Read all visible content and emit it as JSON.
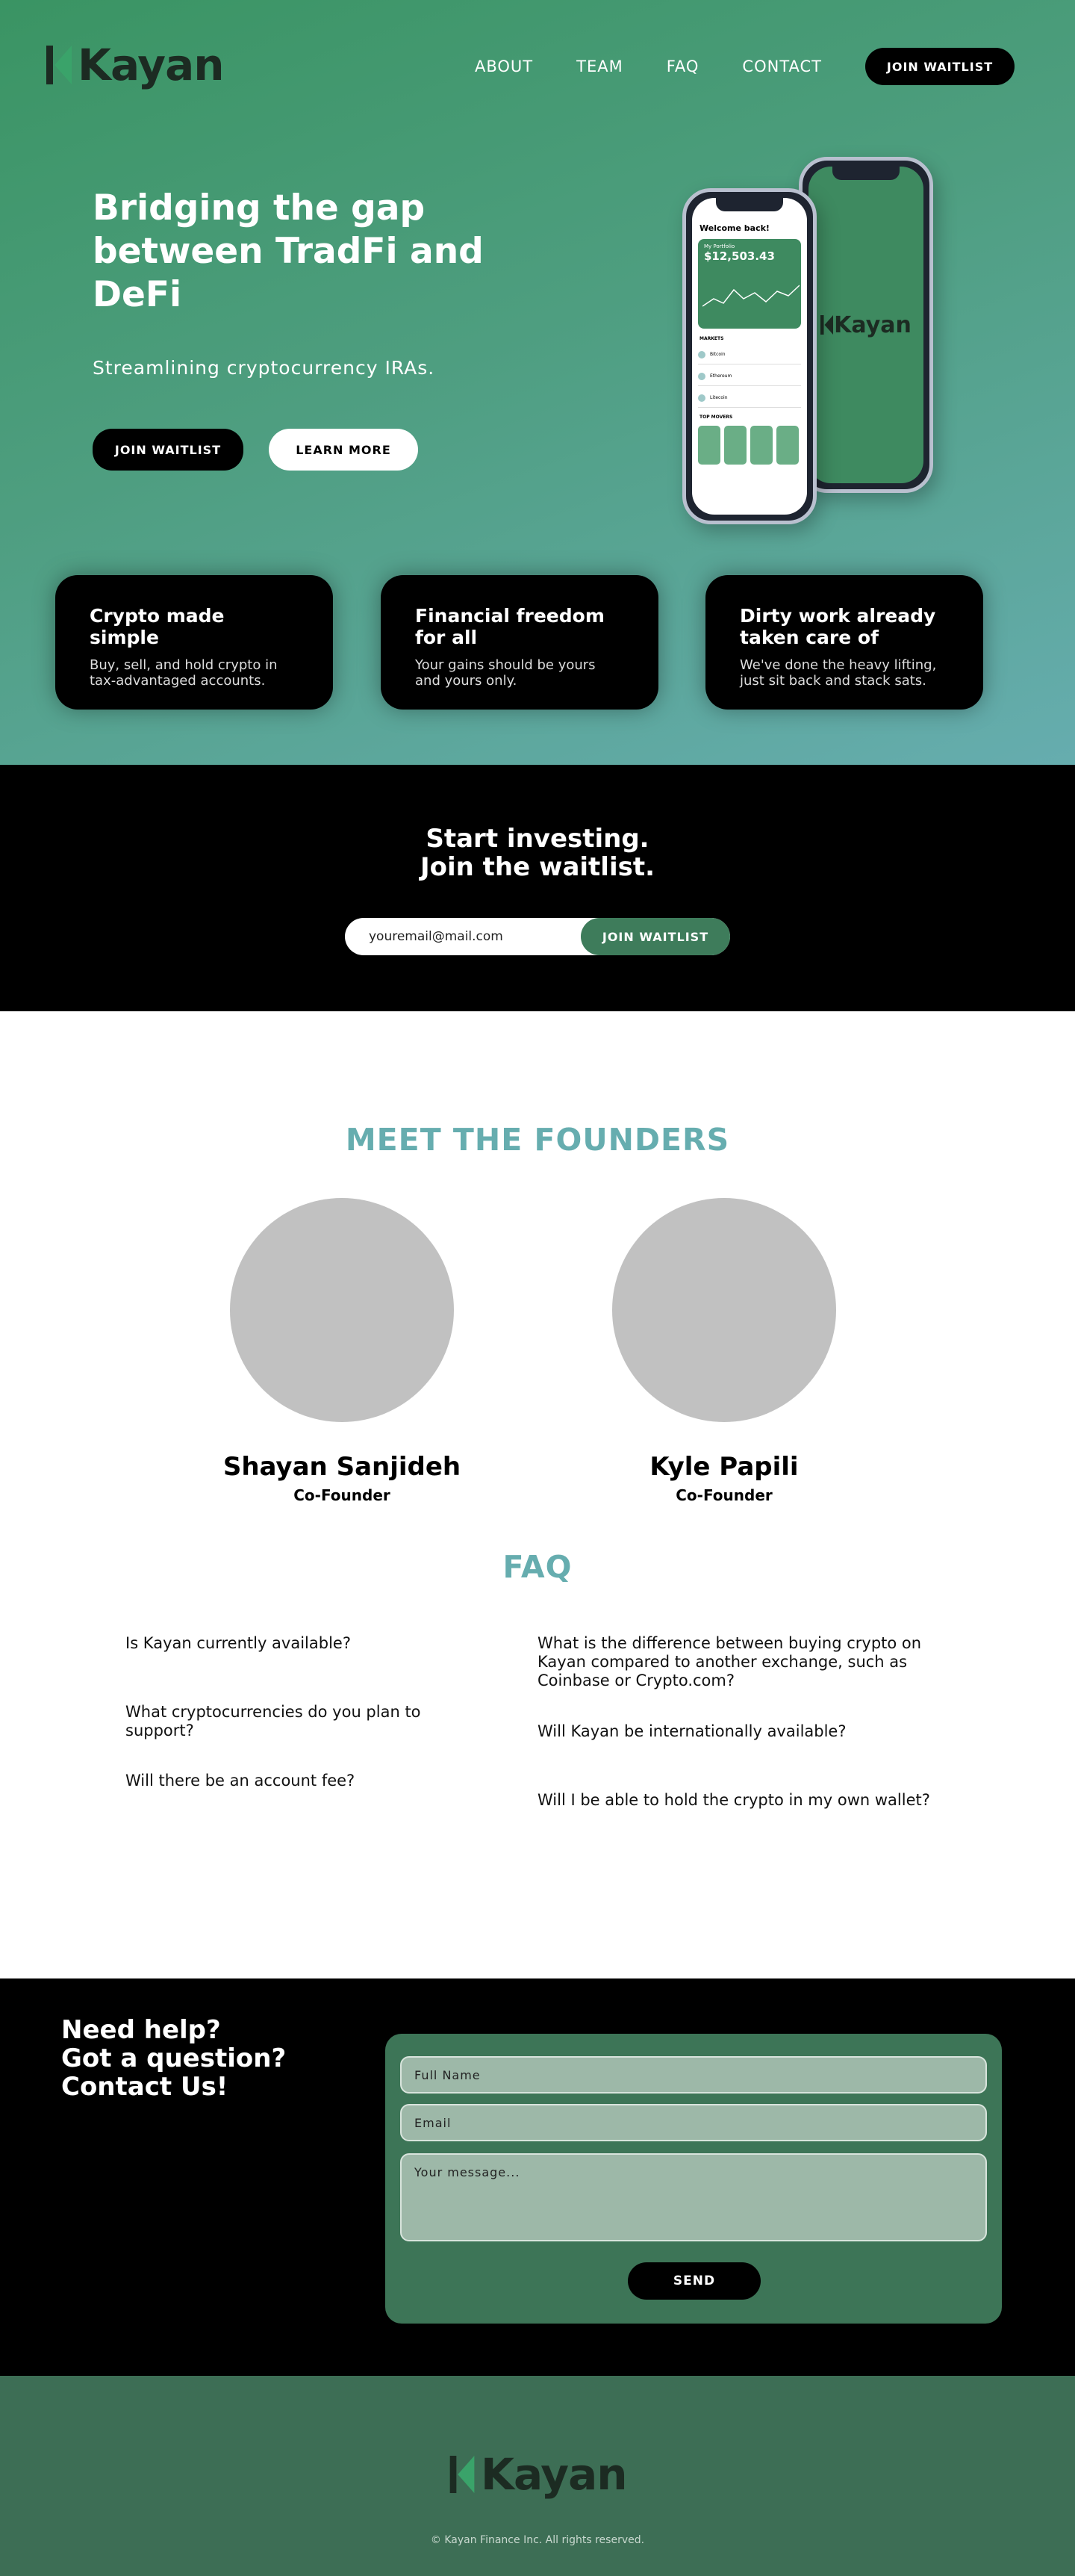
{
  "brand": {
    "name": "Kayan"
  },
  "colors": {
    "accent_green": "#3e7c5b",
    "teal_title": "#66adaf",
    "black": "#000000"
  },
  "nav": {
    "items": [
      "ABOUT",
      "TEAM",
      "FAQ",
      "CONTACT"
    ],
    "cta": "JOIN WAITLIST"
  },
  "hero": {
    "title": "Bridging the gap between TradFi and DeFi",
    "subtitle": "Streamlining cryptocurrency IRAs.",
    "primary_button": "JOIN WAITLIST",
    "secondary_button": "LEARN MORE"
  },
  "phone": {
    "welcome": "Welcome back!",
    "balance_label": "My Portfolio",
    "balance": "$12,503.43",
    "markets_label": "MARKETS",
    "top_movers_label": "TOP MOVERS",
    "coins": [
      "Bitcoin",
      "Ethereum",
      "Litecoin"
    ]
  },
  "features": [
    {
      "title": "Crypto made simple",
      "text": "Buy, sell, and hold crypto in tax-advantaged accounts."
    },
    {
      "title": "Financial freedom for all",
      "text": "Your gains should be yours and yours only."
    },
    {
      "title": "Dirty work already taken care of",
      "text": "We've done the heavy lifting, just sit back and stack sats."
    }
  ],
  "waitlist": {
    "heading_line1": "Start investing.",
    "heading_line2": "Join the waitlist.",
    "email_placeholder": "youremail@mail.com",
    "button": "JOIN WAITLIST"
  },
  "founders": {
    "title": "MEET THE FOUNDERS",
    "people": [
      {
        "name": "Shayan Sanjideh",
        "role": "Co-Founder"
      },
      {
        "name": "Kyle Papili",
        "role": "Co-Founder"
      }
    ]
  },
  "faq": {
    "title": "FAQ",
    "left": [
      "Is Kayan currently available?",
      "What cryptocurrencies do you plan to support?",
      "Will there be an account fee?"
    ],
    "right": [
      "What is the difference between buying crypto on Kayan compared to another exchange, such as Coinbase or Crypto.com?",
      "Will Kayan be internationally available?",
      "Will I be able to hold the crypto in my own wallet?"
    ]
  },
  "contact": {
    "heading_line1": "Need help?",
    "heading_line2": "Got a question?",
    "heading_line3": "Contact Us!",
    "name_placeholder": "Full Name",
    "email_placeholder": "Email",
    "message_placeholder": "Your message...",
    "button": "SEND"
  },
  "footer": {
    "copyright": "© Kayan Finance Inc. All rights reserved."
  }
}
